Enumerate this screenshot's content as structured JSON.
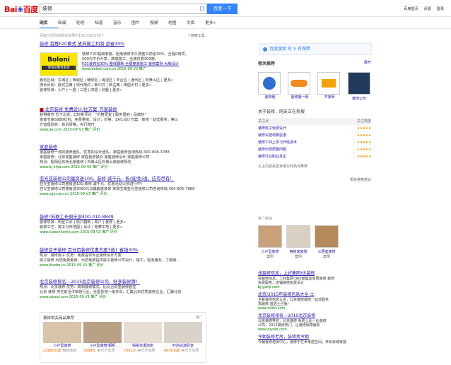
{
  "logo": {
    "text1": "Bai",
    "text2": "百度"
  },
  "search": {
    "query": "装修",
    "button": "百度一下"
  },
  "toplinks": [
    "百度首页",
    "设置",
    "登录"
  ],
  "tabs": [
    "网页",
    "新闻",
    "贴吧",
    "知道",
    "音乐",
    "图片",
    "视频",
    "地图",
    "文库",
    "更多»"
  ],
  "stats": "百度为您找到相关结果约100,000,000个",
  "tools": "搜索工具",
  "results": [
    {
      "title": "装修 首推F2C模式 放弃施工利润 劲省30%",
      "lines": [
        "装修 F2C超级家装，拒绝装修中介费施工劲省30%，全程0增项，",
        "509元平价升享，高端施工，全城仅限300席。",
        "F2C装修省30%  整体翻新  全屋整装施工  装修案例  大牌设计",
        "www.boloni.com.cn  2015-09  V3  推广",
        "服务区域：东城区 | 西城区 | 朝阳区 | 海淀区 | 丰台区 | 通州区 | 石景山区 | 更多»",
        "搜长风网：欧式古典 | 现代简约 | 新中式 | 新古典 | 田园乡村 | 更多»",
        "装修项目：小户 | 一居 | 三居 | 四居 | 别墅 | 更多»"
      ]
    },
    {
      "title": "北京装修 免费设计/比方案_齐家装修",
      "lines": [
        "获得商务 位于北京...136条评论 · “价格便宜 | 服务周到 | 品牌好”",
        "家装节争5888红包，免费量房，设计，价格，1对1设计方案，装修一站式服务，第三",
        "方监理验收，投诉保障，先行赔付",
        "www.jia.com  2015-09  V3  推广  评价"
      ]
    },
    {
      "title": "家庭装修",
      "lines": [
        "家庭装修一流的装修团队，优秀的设计团队，家庭装修咨询热线:400-008-3788",
        "家庭装修：北京家庭装修  家庭装修报价  家庭装修设计  家庭装修公司",
        "热点：昭阳区石桥北家装修 | 石景山区石景山家装修预约",
        "www.bj-xtjia.com  2015-09  V2  推广  评价"
      ]
    },
    {
      "title": "亚光亚装修公司量房送100。装修 减千元，折/减/免/送，应有尽有！",
      "lines": [
        "亚光亚装修公司量房送100,装修 减千元，优惠活动火热进行中！",
        "亚光亚装修公司量房送3000元马桶套装装修 家装宝典亚光亚装修公司咨询热线:400-805-7889",
        "www.ygy.com.cn  2015-09  V3  推广  评价"
      ]
    },
    {
      "title": "装修?苏联工长俱乐部400-010-8849",
      "lines": [
        "装修项目：明星工长 | 局户翻新 | 局户 | 装修 | 更多»",
        "装修工艺：施工分布地图 | 设计 | 考察工地 | 更多»",
        "www.suwanhome.com  2015-09  V3  推广  评价"
      ]
    },
    {
      "title": "装修房子装修 百分百装修优惠方案3选1 省钱30%",
      "lines": [
        "热点：装修房子  优势：免费提供专业装修设计方案",
        "房子装修 为您免费量房，为您免费提供房子装修公司设计，施工，验收服务，了解房...",
        "www.jhxdzs.cn  2015-09  V1  推广  评价"
      ]
    },
    {
      "title": "北京装修排名—2015北京装修公司，好多装修牌！",
      "lines": [
        "热点：北京装修 优势：宾和装修模式，比比合同里装修管控",
        "北京 装修 排名前全市家装行业，全国各地一房多年，汇集北京优秀装修企业，汇聚北京",
        "www.sdsod.com  2015-09  V1  推广  评价"
      ]
    }
  ],
  "products": {
    "header": "装修相关商品推荐",
    "ad": "推广",
    "items": [
      {
        "name": "小户型装修",
        "price": "23800元起",
        "tag": "精诚装饰"
      },
      {
        "name": "小户型装修/橱柜",
        "price": "2698元",
        "tag": "美乐乐家居"
      },
      {
        "name": "榻榻米潮流床",
        "price": "7361元",
        "tag": "美乐乐家居"
      },
      {
        "name": "时尚白漆卧室",
        "price": "4636元起",
        "tag": "美乐乐家居"
      }
    ]
  },
  "right": {
    "badge": "百度搜索  有 V 有保障",
    "related": "相关推荐",
    "expand": "展开",
    "brands": [
      {
        "name": "装饰网"
      },
      {
        "name": "装修第一网"
      },
      {
        "name": "齐家网"
      },
      {
        "name": "装饰公司"
      }
    ],
    "hot_title": "关于装修，网友正在热搜",
    "col1": "关注点",
    "col2": "关注热度",
    "hot": [
      "装修房子免费设计",
      "装修买建材那些很",
      "装修工商上学习开班技术",
      "装修出现质量问题",
      "装修行业职业发生"
    ],
    "hot_note": "以上内容来自百度实时热点推荐",
    "more": "相关搜索建议",
    "promo_title": "推广链接",
    "promos": [
      {
        "name": "小户型装修",
        "sub": "案例"
      },
      {
        "name": "两房家装修",
        "sub": "案例"
      },
      {
        "name": "三居室装修",
        "sub": "案例"
      }
    ],
    "adlinks": [
      {
        "title": "找装修信息，上好集网!优装修",
        "body": "找装修信息，上好集网!360度集宜家居装修·装修",
        "body2": "免费服务，店铺装修免费设计",
        "url": "bj.ganji.com"
      },
      {
        "title": "北京/2015年装修信息大全-土",
        "body": "全新装修信息大全，北京装修装修一站式服务",
        "body2": "找装修 首选土巴兔!",
        "url": "www.tolito.com"
      },
      {
        "title": "北京装修排名—2015北京装修",
        "body": "北京装修排名，北京装修 免费上比一比装修",
        "body2": "公司，2015装修热门，让装修保障服务",
        "url": "www.biyebi.com"
      },
      {
        "title": "今朝装修老房，装修找今朝",
        "body": "今朝装修老房中心，装修于艺术家居空间，开启京城家装"
      }
    ]
  },
  "colors": {
    "accent": "#3385ff",
    "link": "#1a0dab",
    "highlight": "#cc0000",
    "url": "#008000"
  }
}
